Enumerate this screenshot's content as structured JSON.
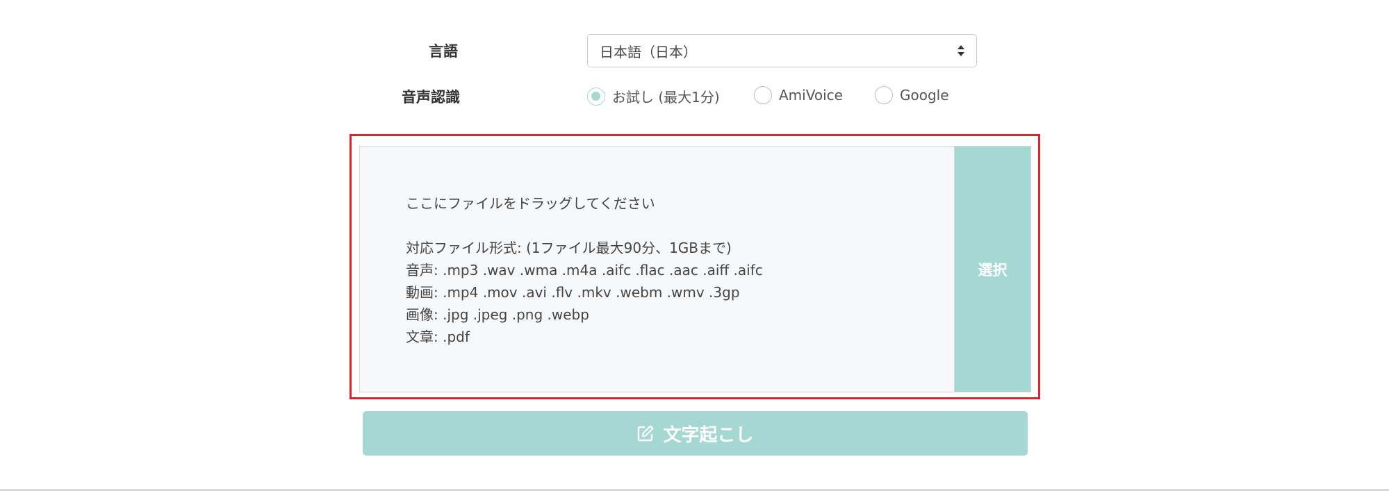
{
  "form": {
    "language": {
      "label": "言語",
      "selected": "日本語（日本）"
    },
    "speech_recognition": {
      "label": "音声認識",
      "options": [
        {
          "label": "お試し (最大1分)",
          "checked": true
        },
        {
          "label": "AmiVoice",
          "checked": false
        },
        {
          "label": "Google",
          "checked": false
        }
      ]
    }
  },
  "dropzone": {
    "instruction": "ここにファイルをドラッグしてください",
    "formats_title": "対応ファイル形式: (1ファイル最大90分、1GBまで)",
    "audio": "音声: .mp3 .wav .wma .m4a .aifc .flac .aac .aiff .aifc",
    "video": "動画: .mp4 .mov .avi .flv .mkv .webm .wmv .3gp",
    "image": "画像: .jpg .jpeg .png .webp",
    "document": "文章: .pdf",
    "select_label": "選択"
  },
  "actions": {
    "transcribe_label": "文字起こし",
    "transcribe_icon": "edit-icon"
  },
  "colors": {
    "accent": "#a5d8d2",
    "highlight": "#d9262a",
    "dropzone_bg": "#f7f8fa"
  }
}
